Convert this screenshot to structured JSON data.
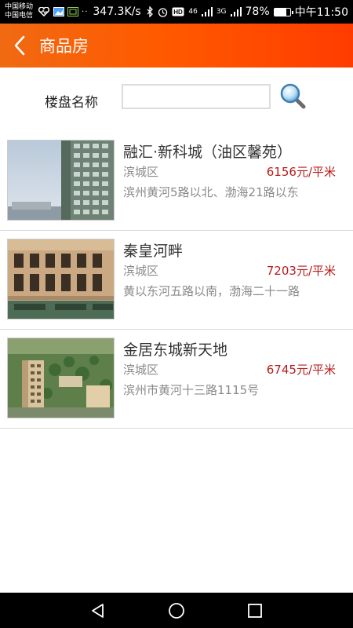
{
  "status_bar": {
    "carrier_1": "中国移动",
    "carrier_2": "中国电信",
    "net_speed": "347.3K/s",
    "signal_label_1": "46",
    "signal_label_2": "3G",
    "battery": "78%",
    "battery_level": 0.78,
    "time": "中午11:50",
    "icons": [
      "heart-rate-icon",
      "gallery-icon",
      "sim-icon",
      "bluetooth-icon",
      "alarm-icon",
      "hd-icon",
      "signal-icon",
      "battery-icon"
    ]
  },
  "header": {
    "back_icon": "chevron-left-icon",
    "title": "商品房"
  },
  "search": {
    "label": "楼盘名称",
    "value": "",
    "placeholder": "",
    "button_icon": "magnifier-icon"
  },
  "listings": [
    {
      "name": "融汇·新科城（油区馨苑）",
      "district": "滨城区",
      "price": "6156元/平米",
      "address": "滨州黄河5路以北、渤海21路以东",
      "image": "tower-building-photo"
    },
    {
      "name": "秦皇河畔",
      "district": "滨城区",
      "price": "7203元/平米",
      "address": "黄以东河五路以南，渤海二十一路",
      "image": "shopfront-building-photo"
    },
    {
      "name": "金居东城新天地",
      "district": "滨城区",
      "price": "6745元/平米",
      "address": "滨州市黄河十三路1115号",
      "image": "aerial-complex-rendering"
    }
  ],
  "nav_bar": {
    "icons": [
      "back-triangle-icon",
      "home-circle-icon",
      "recents-square-icon"
    ]
  },
  "colors": {
    "header_start": "#f06a12",
    "header_end": "#ff3c00",
    "price": "#b81c1c"
  }
}
